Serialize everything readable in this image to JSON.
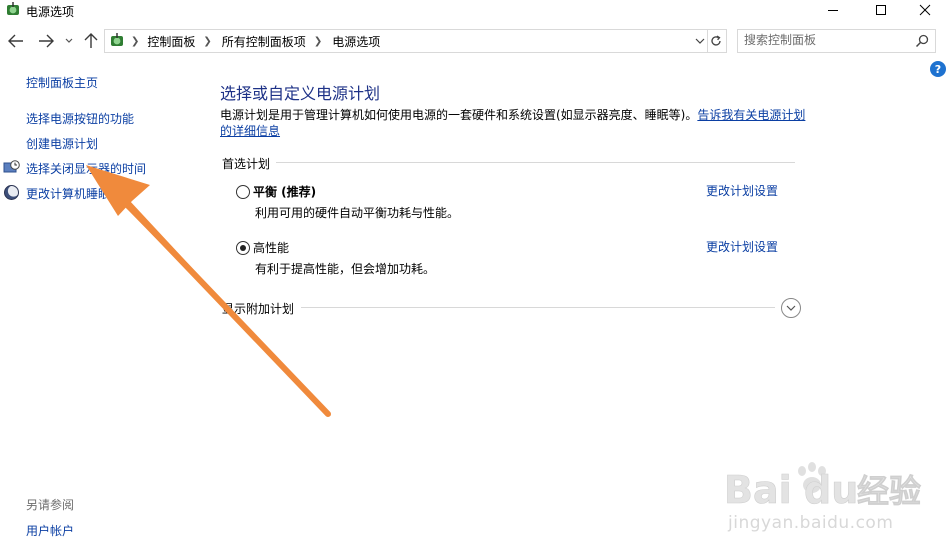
{
  "window": {
    "title": "电源选项",
    "controls": {
      "minimize_icon": "minimize-icon",
      "maximize_icon": "maximize-icon",
      "close_icon": "close-icon"
    }
  },
  "navigation": {
    "back_icon": "arrow-left-icon",
    "forward_icon": "arrow-right-icon",
    "recent_icon": "chevron-down-icon",
    "up_icon": "arrow-up-icon",
    "breadcrumbs": [
      "控制面板",
      "所有控制面板项",
      "电源选项"
    ],
    "refresh_icon": "refresh-icon",
    "search": {
      "placeholder": "搜索控制面板",
      "value": ""
    }
  },
  "sidebar": {
    "home": "控制面板主页",
    "items": [
      {
        "label": "选择电源按钮的功能",
        "icon": ""
      },
      {
        "label": "创建电源计划",
        "icon": ""
      },
      {
        "label": "选择关闭显示器的时间",
        "icon": "monitor-clock-icon"
      },
      {
        "label": "更改计算机睡眠时间",
        "icon": "moon-icon"
      }
    ],
    "see_also": "另请参阅",
    "see_also_items": [
      "用户帐户"
    ]
  },
  "main": {
    "title": "选择或自定义电源计划",
    "description": "电源计划是用于管理计算机如何使用电源的一套硬件和系统设置(如显示器亮度、睡眠等)。",
    "description_link": "告诉我有关电源计划的详细信息",
    "preferred_section": "首选计划",
    "plans": [
      {
        "name": "平衡 (推荐)",
        "description": "利用可用的硬件自动平衡功耗与性能。",
        "selected": false,
        "settings_link": "更改计划设置"
      },
      {
        "name": "高性能",
        "description": "有利于提高性能，但会增加功耗。",
        "selected": true,
        "settings_link": "更改计划设置"
      }
    ],
    "extra_section": "显示附加计划"
  },
  "watermark": {
    "logo_text": "Baidu经验",
    "url": "jingyan.baidu.com"
  },
  "colors": {
    "link": "#0b3fa3",
    "heading": "#1e3287",
    "annotation_arrow": "#f08a3c",
    "help": "#1e72d0"
  }
}
